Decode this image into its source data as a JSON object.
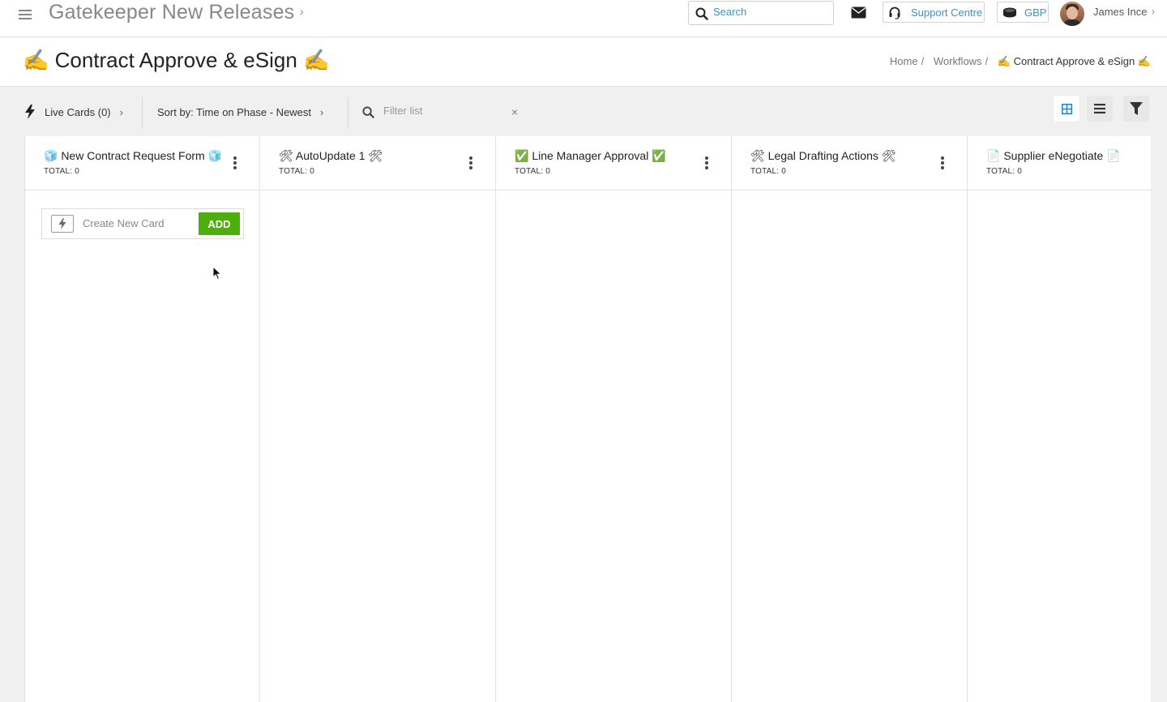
{
  "header": {
    "app_title": "Gatekeeper New Releases",
    "search_placeholder": "Search",
    "support_label": "Support Centre",
    "currency_label": "GBP",
    "user_name": "James Ince"
  },
  "page": {
    "title": "✍️ Contract Approve & eSign ✍️",
    "breadcrumb": {
      "items": [
        "Home",
        "Workflows"
      ],
      "current": "✍️ Contract Approve & eSign ✍️"
    }
  },
  "toolbar": {
    "live_cards_label": "Live Cards (0)",
    "sort_label": "Sort by: Time on Phase - Newest",
    "filter_placeholder": "Filter list",
    "clear_glyph": "×"
  },
  "columns": [
    {
      "title": "🧊 New Contract Request Form 🧊",
      "total": "TOTAL: 0"
    },
    {
      "title": "🛠 AutoUpdate 1  🛠",
      "total": "TOTAL: 0"
    },
    {
      "title": "✅ Line Manager Approval ✅",
      "total": "TOTAL: 0"
    },
    {
      "title": "🛠 Legal Drafting Actions 🛠",
      "total": "TOTAL: 0"
    },
    {
      "title": "📄 Supplier eNegotiate 📄",
      "total": "TOTAL: 0"
    }
  ],
  "new_card": {
    "placeholder": "Create New Card",
    "add_label": "ADD"
  },
  "colors": {
    "accent_blue": "#3a93c8",
    "add_green": "#4caf0e"
  },
  "icons": {
    "menu": "hamburger-icon",
    "search": "search-icon",
    "mail": "envelope-icon",
    "support": "headset-icon",
    "currency": "coins-icon",
    "live": "lightning-icon",
    "grid_view": "grid-view-icon",
    "list_view": "list-view-icon",
    "filter": "funnel-icon"
  }
}
